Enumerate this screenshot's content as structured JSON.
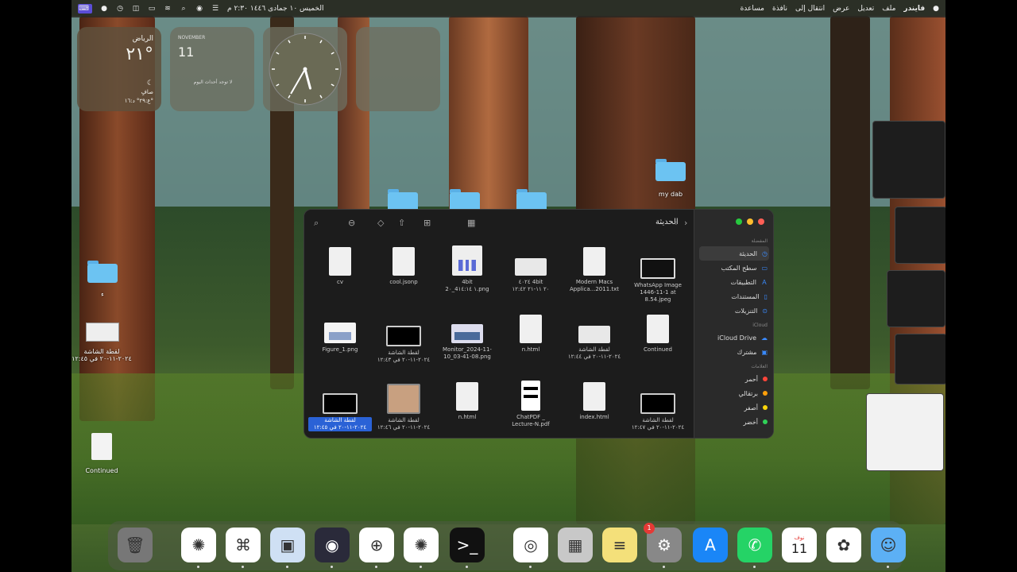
{
  "menubar": {
    "left_items": [
      {
        "icon": "apple-logo-icon",
        "label": ""
      },
      {
        "label": "فايندر"
      },
      {
        "label": "ملف"
      },
      {
        "label": "تعديل"
      },
      {
        "label": "عرض"
      },
      {
        "label": "انتقال إلى"
      },
      {
        "label": "نافذة"
      },
      {
        "label": "مساعدة"
      }
    ],
    "clock": "الخميس ١٠ جمادى ١٤٤٦ ٢:٣٠ م",
    "status_icons": [
      "control-center-icon",
      "siri-icon",
      "spotlight-icon",
      "wifi-icon",
      "battery-icon",
      "screen-record-icon",
      "clock-icon",
      "focus-icon",
      "keyboard-icon"
    ]
  },
  "widgets": {
    "weather": {
      "city": "الرياض",
      "temp": "٢١°",
      "condition": "صافٍ",
      "range": "ع:٢٩° د:١٦°"
    },
    "calendar": {
      "month": "NOVEMBER",
      "day": "11",
      "note": "لا توجد أحداث اليوم"
    },
    "clock": {
      "hour_angle": 165,
      "minute_angle": 210
    },
    "empty": {}
  },
  "desktop_items": [
    {
      "name": "my-dab",
      "label": "my dab",
      "type": "folder"
    },
    {
      "name": "folder-1",
      "label": "",
      "type": "folder"
    },
    {
      "name": "folder-2",
      "label": "",
      "type": "folder"
    },
    {
      "name": "folder-3",
      "label": "",
      "type": "folder"
    },
    {
      "name": "folder-left",
      "label": "ء",
      "type": "folder"
    },
    {
      "name": "screenshot-left",
      "label": "لقطة الشاشة\n٢٠٢٤-١١-٢٠ في ١٢:٤٥",
      "type": "image"
    },
    {
      "name": "continued-left",
      "label": "Continued",
      "type": "file"
    }
  ],
  "finder": {
    "title": "الحديثة",
    "toolbar_icons": [
      "search-icon",
      "more-icon",
      "tag-icon",
      "share-icon",
      "group-icon",
      "view-icon"
    ],
    "files": [
      {
        "label": "cv",
        "thumb": "doc"
      },
      {
        "label": "cool.jsonp",
        "thumb": "doc"
      },
      {
        "label": "4bit\n2٠_4١ ١٤:١٤.png",
        "thumb": "chart"
      },
      {
        "label": "٤٠٢٤ 4bit\n٢٠ ١١-٢١ ١٢:٤٢",
        "thumb": "blank"
      },
      {
        "label": "Modern Macs\nApplica...2011.txt",
        "thumb": "doc"
      },
      {
        "label": "WhatsApp Image\n1446-11-1 at 8.54.jpeg",
        "thumb": "screen"
      },
      {
        "label": "Figure_1.png",
        "thumb": "figure"
      },
      {
        "label": "لقطة الشاشة\n٢٠٢٤-١١-٢٠ في ١٢:٤٣",
        "thumb": "screen-dark"
      },
      {
        "label": "Monitor_2024-11-\n10_03-41-08.png",
        "thumb": "monitor"
      },
      {
        "label": "n.html",
        "thumb": "doc"
      },
      {
        "label": "لقطة الشاشة\n٢٠٢٤-١١-٢٠ في ١٢:٤٤",
        "thumb": "blank"
      },
      {
        "label": "Continued",
        "thumb": "doc"
      },
      {
        "label": "لقطة الشاشة\n٢٠٢٤-١١-٢٠ في ١٢:٤٥",
        "thumb": "screen-dark",
        "selected": true
      },
      {
        "label": "لقطة الشاشة\n٢٠٢٤-١١-٢٠ في ١٢:٤٦",
        "thumb": "photo"
      },
      {
        "label": "n.html",
        "thumb": "doc"
      },
      {
        "label": "ChatPDF _\nLecture-N.pdf",
        "thumb": "pdf"
      },
      {
        "label": "index.html",
        "thumb": "doc"
      },
      {
        "label": "لقطة الشاشة\n٢٠٢٤-١١-٢٠ في ١٢:٤٧",
        "thumb": "screen-dark"
      }
    ],
    "sidebar": {
      "favorites_title": "المفضلة",
      "favorites": [
        {
          "label": "الحديثة",
          "icon": "clock-icon",
          "selected": true
        },
        {
          "label": "سطح المكتب",
          "icon": "desktop-icon"
        },
        {
          "label": "التطبيقات",
          "icon": "apps-icon"
        },
        {
          "label": "المستندات",
          "icon": "document-icon"
        },
        {
          "label": "التنزيلات",
          "icon": "download-icon"
        }
      ],
      "icloud_title": "iCloud",
      "icloud": [
        {
          "label": "iCloud Drive",
          "icon": "cloud-icon"
        },
        {
          "label": "مشترك",
          "icon": "shared-icon"
        }
      ],
      "tags_title": "العلامات",
      "tags": [
        {
          "label": "أحمر",
          "color": "#ff453a"
        },
        {
          "label": "برتقالي",
          "color": "#ff9f0a"
        },
        {
          "label": "أصفر",
          "color": "#ffd60a"
        },
        {
          "label": "أخضر",
          "color": "#30d158"
        }
      ]
    }
  },
  "dock": {
    "apps": [
      {
        "name": "trash",
        "label": "سلة المهملات",
        "running": false
      },
      {
        "name": "chatgpt",
        "label": "ChatGPT",
        "running": true
      },
      {
        "name": "vscode",
        "label": "Visual Studio Code",
        "running": true
      },
      {
        "name": "preview",
        "label": "Preview",
        "running": true
      },
      {
        "name": "quicktime",
        "label": "QuickTime Player",
        "running": true
      },
      {
        "name": "safari",
        "label": "Safari",
        "running": true
      },
      {
        "name": "chatgpt-2",
        "label": "ChatGPT",
        "running": true
      },
      {
        "name": "terminal",
        "label": "Terminal",
        "running": true
      },
      {
        "name": "chrome",
        "label": "Google Chrome",
        "running": true
      },
      {
        "name": "launchpad",
        "label": "Launchpad",
        "running": false
      },
      {
        "name": "notes",
        "label": "Notes",
        "running": false
      },
      {
        "name": "settings",
        "label": "System Settings",
        "running": true,
        "badge": "1"
      },
      {
        "name": "app-store",
        "label": "App Store",
        "running": false
      },
      {
        "name": "whatsapp",
        "label": "WhatsApp",
        "running": true
      },
      {
        "name": "calendar",
        "label": "Calendar",
        "running": false,
        "day": "11",
        "month": "نوف"
      },
      {
        "name": "photos",
        "label": "Photos",
        "running": false
      },
      {
        "name": "finder",
        "label": "Finder",
        "running": true
      }
    ]
  },
  "colors": {
    "accent": "#2a62d6",
    "folder_blue": "#6cc3f2",
    "finder_bg": "#1c1c1c",
    "sidebar_bg": "#2a2a2a"
  }
}
